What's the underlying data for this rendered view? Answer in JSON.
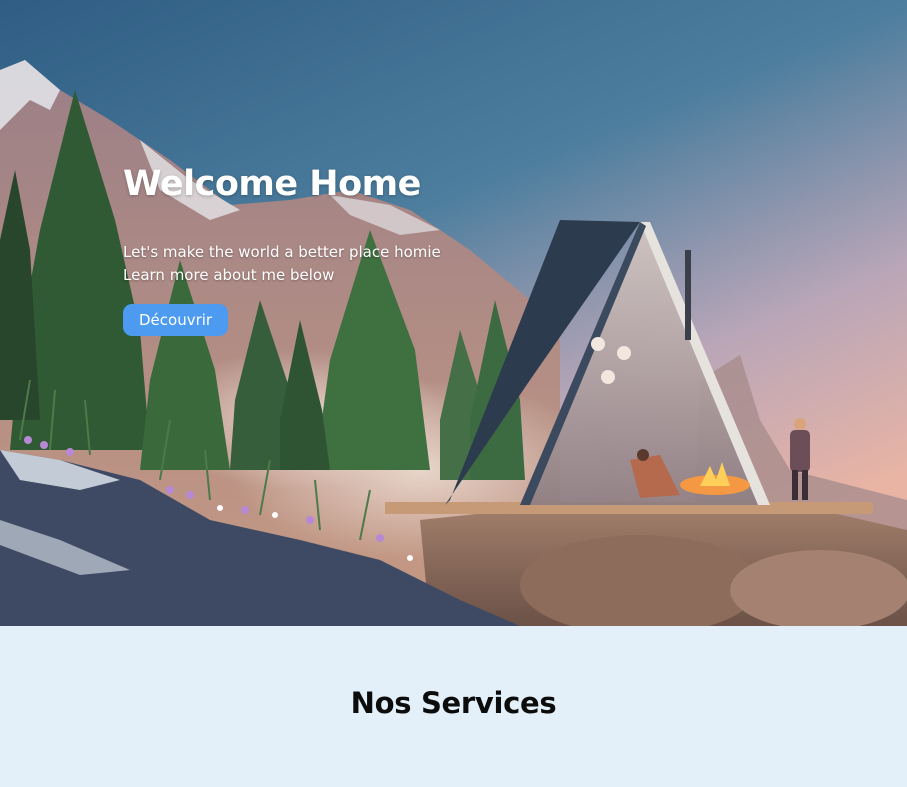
{
  "hero": {
    "title": "Welcome Home",
    "subtitle_line1": "Let's make the world a better place homie",
    "subtitle_line2": "Learn more about me below",
    "cta_label": "Découvrir",
    "cta_color": "#4c9bf0",
    "background_image": "mountain-a-frame-cabin-illustration"
  },
  "services": {
    "heading": "Nos Services",
    "background": "#e3eff9"
  }
}
